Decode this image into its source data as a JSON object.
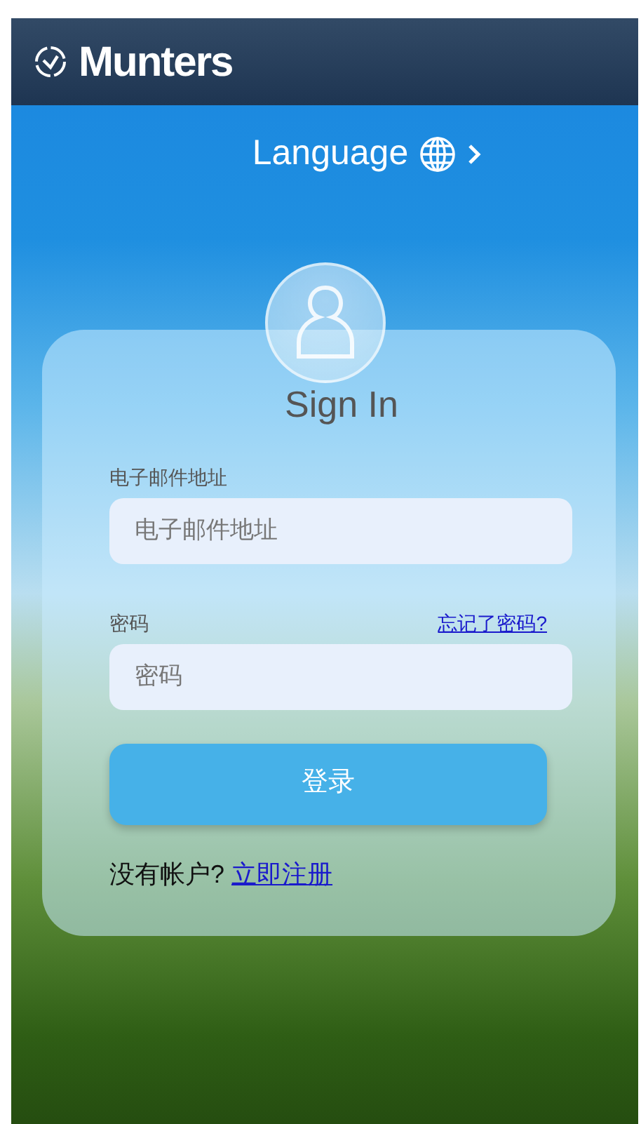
{
  "header": {
    "brand": "Munters"
  },
  "language": {
    "label": "Language"
  },
  "sign_in": {
    "title": "Sign In",
    "email": {
      "label": "电子邮件地址",
      "placeholder": "电子邮件地址"
    },
    "password": {
      "label": "密码",
      "placeholder": "密码"
    },
    "forgot_link": "忘记了密码?",
    "login_button": "登录",
    "signup": {
      "prompt": "没有帐户?",
      "link": "立即注册"
    }
  }
}
